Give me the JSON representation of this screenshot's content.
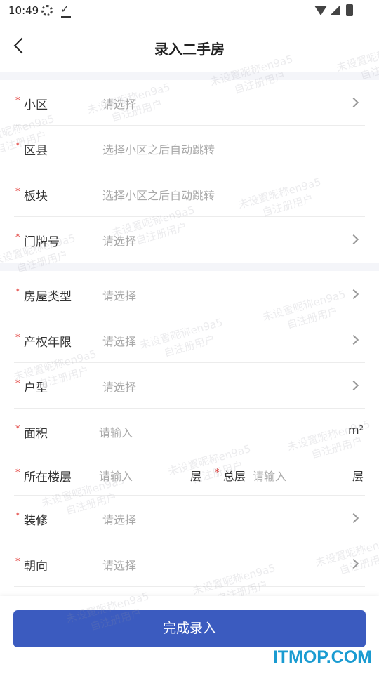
{
  "status_bar": {
    "time": "10:49"
  },
  "header": {
    "title": "录入二手房"
  },
  "section1": [
    {
      "label": "小区",
      "value": "请选择"
    },
    {
      "label": "区县",
      "value": "选择小区之后自动跳转"
    },
    {
      "label": "板块",
      "value": "选择小区之后自动跳转"
    },
    {
      "label": "门牌号",
      "value": "请选择"
    }
  ],
  "section2": [
    {
      "label": "房屋类型",
      "value": "请选择"
    },
    {
      "label": "产权年限",
      "value": "请选择"
    },
    {
      "label": "户型",
      "value": "请选择"
    }
  ],
  "area": {
    "label": "面积",
    "placeholder": "请输入",
    "unit": "m²"
  },
  "floor": {
    "label": "所在楼层",
    "placeholder": "请输入",
    "unit": "层",
    "total_label": "总层",
    "total_placeholder": "请输入",
    "total_unit": "层"
  },
  "section3": [
    {
      "label": "装修",
      "value": "请选择"
    },
    {
      "label": "朝向",
      "value": "请选择"
    }
  ],
  "required_mark": "*",
  "footer": {
    "submit_label": "完成录入"
  },
  "watermark": {
    "line1": "未设置昵称en9a5",
    "line2": "自注册用户"
  },
  "site_mark": "ITMOP.COM",
  "colors": {
    "accent": "#3b5bbf",
    "required": "#e0312d",
    "placeholder": "#a9a9a9"
  }
}
